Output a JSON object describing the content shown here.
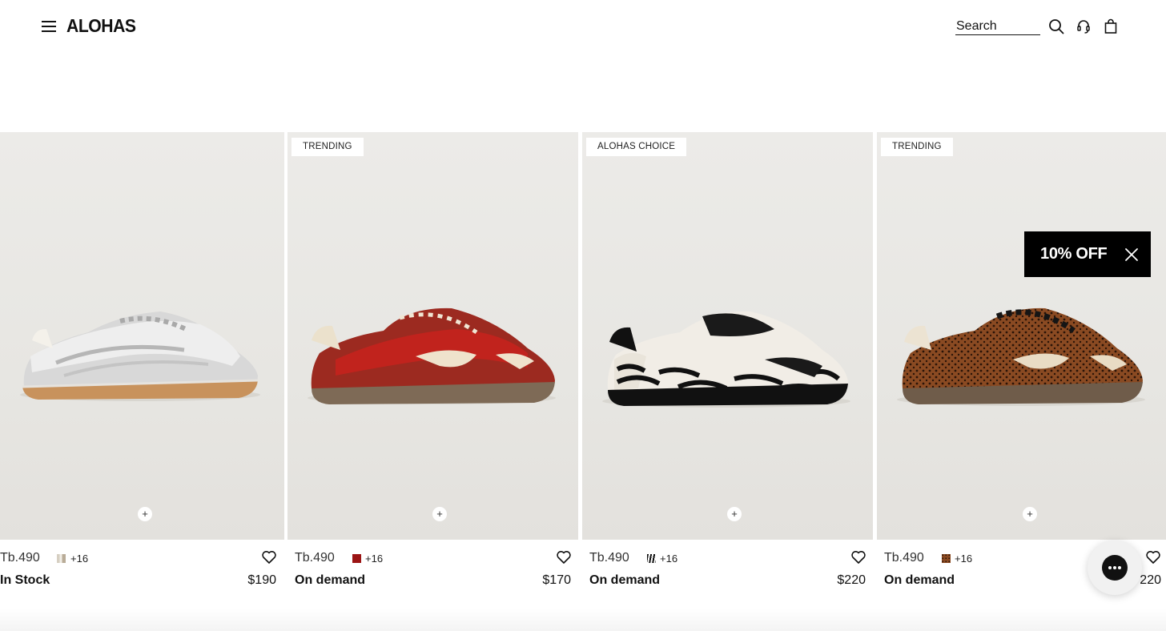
{
  "header": {
    "logo": "ALOHAS",
    "search_label": "Search"
  },
  "products": [
    {
      "badge": "",
      "model": "Tb.490",
      "more_colors": "+16",
      "availability": "In Stock",
      "price": "$190",
      "swatch_color": "#d9d2c6"
    },
    {
      "badge": "TRENDING",
      "model": "Tb.490",
      "more_colors": "+16",
      "availability": "On demand",
      "price": "$170",
      "swatch_color": "#9b1414"
    },
    {
      "badge": "ALOHAS CHOICE",
      "model": "Tb.490",
      "more_colors": "+16",
      "availability": "On demand",
      "price": "$220",
      "swatch_color": "#1a1a1a"
    },
    {
      "badge": "TRENDING",
      "model": "Tb.490",
      "more_colors": "+16",
      "availability": "On demand",
      "price": "220",
      "swatch_color": "#7a3f1c"
    }
  ],
  "promo": {
    "label": "10% OFF"
  },
  "colors": {
    "accent": "#000000",
    "background": "#ffffff",
    "photo_bg": "#e9e8e5"
  }
}
